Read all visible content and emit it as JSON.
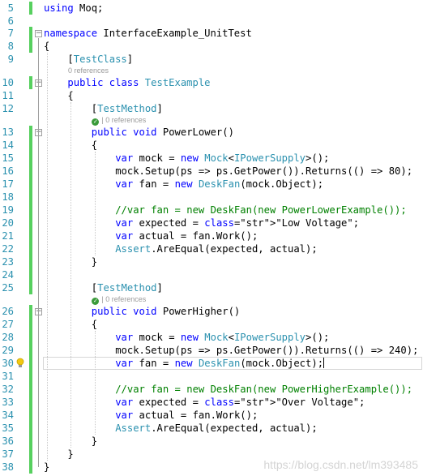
{
  "editor": {
    "lines": [
      {
        "n": "5",
        "text": "using Moq;"
      },
      {
        "n": "6",
        "text": ""
      },
      {
        "n": "7",
        "text": "namespace InterfaceExample_UnitTest"
      },
      {
        "n": "8",
        "text": "{"
      },
      {
        "n": "9",
        "text": "[TestClass]"
      },
      {
        "n": "10",
        "text": "public class TestExample"
      },
      {
        "n": "11",
        "text": "{"
      },
      {
        "n": "12",
        "text": "[TestMethod]"
      },
      {
        "n": "13",
        "text": "public void PowerLower()"
      },
      {
        "n": "14",
        "text": "{"
      },
      {
        "n": "15",
        "text": "var mock = new Mock<IPowerSupply>();"
      },
      {
        "n": "16",
        "text": "mock.Setup(ps => ps.GetPower()).Returns(() => 80);"
      },
      {
        "n": "17",
        "text": "var fan = new DeskFan(mock.Object);"
      },
      {
        "n": "18",
        "text": ""
      },
      {
        "n": "19",
        "text": "//var fan = new DeskFan(new PowerLowerExample());"
      },
      {
        "n": "20",
        "text": "var expected = \"Low Voltage\";"
      },
      {
        "n": "21",
        "text": "var actual = fan.Work();"
      },
      {
        "n": "22",
        "text": "Assert.AreEqual(expected, actual);"
      },
      {
        "n": "23",
        "text": "}"
      },
      {
        "n": "24",
        "text": ""
      },
      {
        "n": "25",
        "text": "[TestMethod]"
      },
      {
        "n": "26",
        "text": "public void PowerHigher()"
      },
      {
        "n": "27",
        "text": "{"
      },
      {
        "n": "28",
        "text": "var mock = new Mock<IPowerSupply>();"
      },
      {
        "n": "29",
        "text": "mock.Setup(ps => ps.GetPower()).Returns(() => 240);"
      },
      {
        "n": "30",
        "text": "var fan = new DeskFan(mock.Object);"
      },
      {
        "n": "31",
        "text": ""
      },
      {
        "n": "32",
        "text": "//var fan = new DeskFan(new PowerHigherExample());"
      },
      {
        "n": "33",
        "text": "var expected = \"Over Voltage\";"
      },
      {
        "n": "34",
        "text": "var actual = fan.Work();"
      },
      {
        "n": "35",
        "text": "Assert.AreEqual(expected, actual);"
      },
      {
        "n": "36",
        "text": "}"
      },
      {
        "n": "37",
        "text": "}"
      },
      {
        "n": "38",
        "text": "}"
      }
    ],
    "codelens": {
      "class_refs": "0 references",
      "method1_refs": "0 references",
      "method2_refs": "0 references"
    },
    "current_line": "30"
  },
  "watermark": "https://blog.csdn.net/lm393485",
  "colors": {
    "keyword": "#0000ff",
    "type": "#2b91af",
    "string": "#a31515",
    "comment": "#008000",
    "line_number": "#2b91af",
    "change_bar": "#57d05f"
  },
  "icons": {
    "test_passed": "check-circle-icon",
    "quick_action": "lightbulb-icon"
  }
}
